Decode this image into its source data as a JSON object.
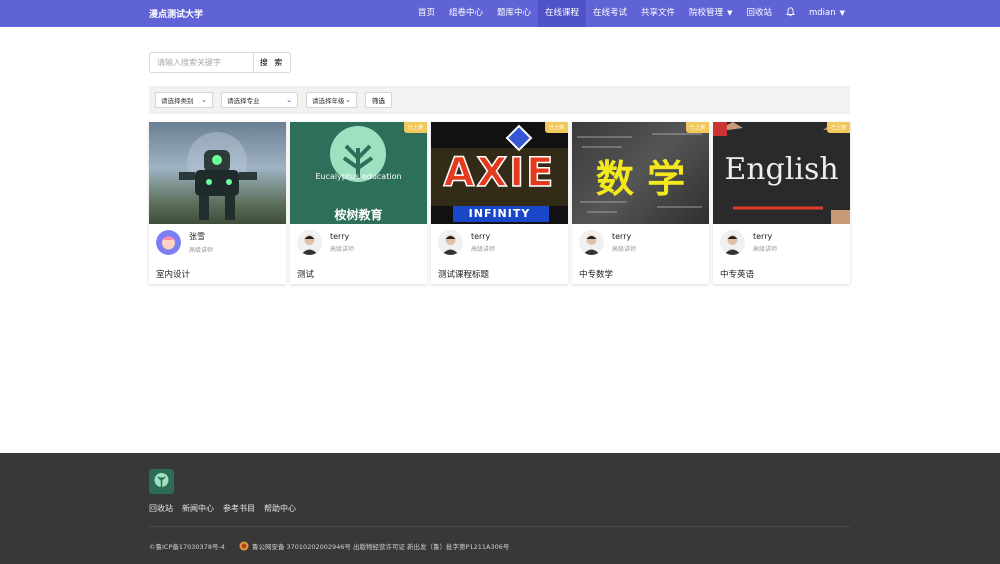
{
  "header": {
    "brand": "漫点测试大学",
    "nav": [
      {
        "label": "首页"
      },
      {
        "label": "组卷中心"
      },
      {
        "label": "题库中心"
      },
      {
        "label": "在线课程"
      },
      {
        "label": "在线考试"
      },
      {
        "label": "共享文件"
      },
      {
        "label": "院校管理"
      },
      {
        "label": "回收站"
      }
    ],
    "user": "mdian"
  },
  "search": {
    "placeholder": "请输入搜索关键字",
    "button": "搜 索"
  },
  "filters": {
    "category": "请选择类别",
    "major": "请选择专业",
    "grade": "请选择年级",
    "button": "筛选"
  },
  "courses": [
    {
      "teacher": "张雪",
      "teacher_title": "高级讲师",
      "title": "室内设计",
      "badge": ""
    },
    {
      "teacher": "terry",
      "teacher_title": "高级讲师",
      "title": "测试",
      "badge": "已上架",
      "thumb_text": "Eucalyptus education",
      "thumb_text2": "桉树教育"
    },
    {
      "teacher": "terry",
      "teacher_title": "高级讲师",
      "title": "测试课程标题",
      "badge": "已上架",
      "thumb_text": "AXIE",
      "thumb_text2": "INFINITY"
    },
    {
      "teacher": "terry",
      "teacher_title": "高级讲师",
      "title": "中专数学",
      "badge": "已上架",
      "thumb_text": "数 学"
    },
    {
      "teacher": "terry",
      "teacher_title": "高级讲师",
      "title": "中专英语",
      "badge": "已上架",
      "thumb_text": "English"
    }
  ],
  "footer": {
    "links": [
      "回收站",
      "新闻中心",
      "参考书目",
      "帮助中心"
    ],
    "icp": "©鲁ICP备17030378号-4",
    "police": "鲁公网安备 37010202002946号 出版物经营许可证 新出发（鲁）批字第P1211A306号"
  },
  "colors": {
    "topbar": "#5f63d6",
    "footer": "#383838",
    "badge": "#f3c85a"
  }
}
